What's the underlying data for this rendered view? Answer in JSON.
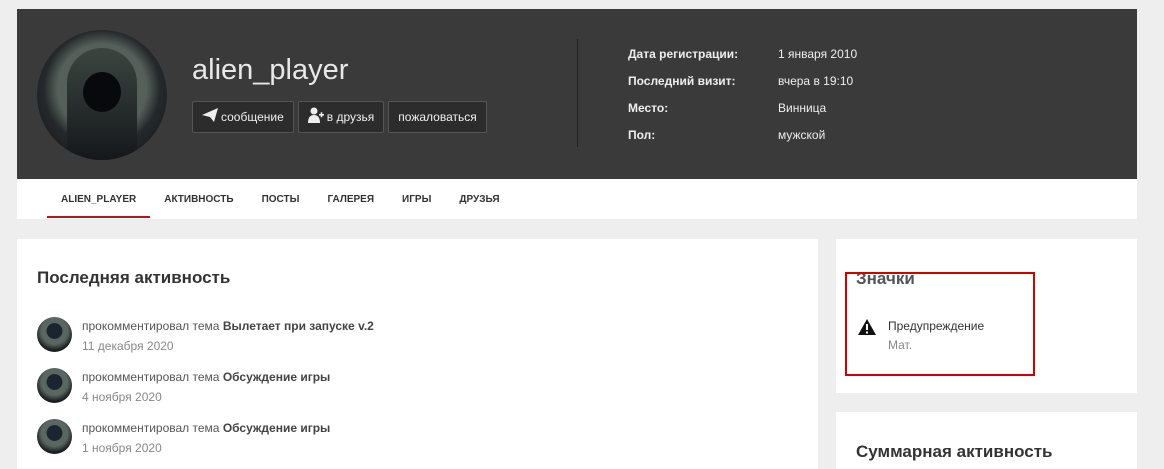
{
  "profile": {
    "username": "alien_player",
    "buttons": {
      "message": "сообщение",
      "add_friend": "в друзья",
      "report": "пожаловаться"
    },
    "info": [
      {
        "key": "Дата регистрации:",
        "value": "1 января 2010"
      },
      {
        "key": "Последний визит:",
        "value": "вчера в 19:10"
      },
      {
        "key": "Место:",
        "value": "Винница"
      },
      {
        "key": "Пол:",
        "value": "мужской"
      }
    ]
  },
  "tabs": [
    "ALIEN_PLAYER",
    "АКТИВНОСТЬ",
    "ПОСТЫ",
    "ГАЛЕРЕЯ",
    "ИГРЫ",
    "ДРУЗЬЯ"
  ],
  "activity": {
    "title": "Последняя активность",
    "items": [
      {
        "action": "прокомментировал тема",
        "topic": "Вылетает при запуске v.2",
        "date": "11 декабря 2020"
      },
      {
        "action": "прокомментировал тема",
        "topic": "Обсуждение игры",
        "date": "4 ноября 2020"
      },
      {
        "action": "прокомментировал тема",
        "topic": "Обсуждение игры",
        "date": "1 ноября 2020"
      }
    ]
  },
  "badges": {
    "title": "Значки",
    "items": [
      {
        "icon": "warning-icon",
        "label": "Предупреждение",
        "sub": "Мат."
      }
    ]
  },
  "summary": {
    "title": "Суммарная активность"
  },
  "colors": {
    "header_bg": "#3a3a3a",
    "accent": "#b5141a",
    "highlight": "#d40000"
  }
}
